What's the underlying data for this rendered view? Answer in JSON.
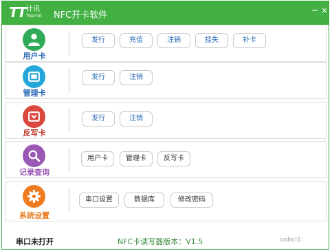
{
  "app": {
    "logo_cn": "计讯",
    "logo_en": "Top-iot",
    "title": "NFC开卡软件",
    "minimize": "−",
    "close": "×"
  },
  "rows": [
    {
      "label": "用户卡",
      "label_color": "#2b6bb8",
      "icon": "user-icon",
      "icon_color": "#2faa56",
      "buttons": [
        "发行",
        "充值",
        "注销",
        "挂失",
        "补卡"
      ]
    },
    {
      "label": "管理卡",
      "label_color": "#2b6bb8",
      "icon": "card-icon",
      "icon_color": "#23a7d8",
      "buttons": [
        "发行",
        "注销"
      ]
    },
    {
      "label": "反写卡",
      "label_color": "#c0392b",
      "icon": "card-icon",
      "icon_color": "#d9473e",
      "buttons": [
        "发行",
        "注销"
      ]
    },
    {
      "label": "记录查询",
      "label_color": "#9b59b6",
      "icon": "search-icon",
      "icon_color": "#9b59b6",
      "buttons": [
        "用户卡",
        "管理卡",
        "反写卡"
      ]
    },
    {
      "label": "系统设置",
      "label_color": "#e67e22",
      "icon": "gear-icon",
      "icon_color": "#f07b1f",
      "buttons": [
        "串口设置",
        "数据库",
        "修改密码"
      ]
    }
  ],
  "status": {
    "port": "串口未打开",
    "version": "NFC卡读写器版本：V1.5",
    "watermark": "iodn:i1:"
  }
}
